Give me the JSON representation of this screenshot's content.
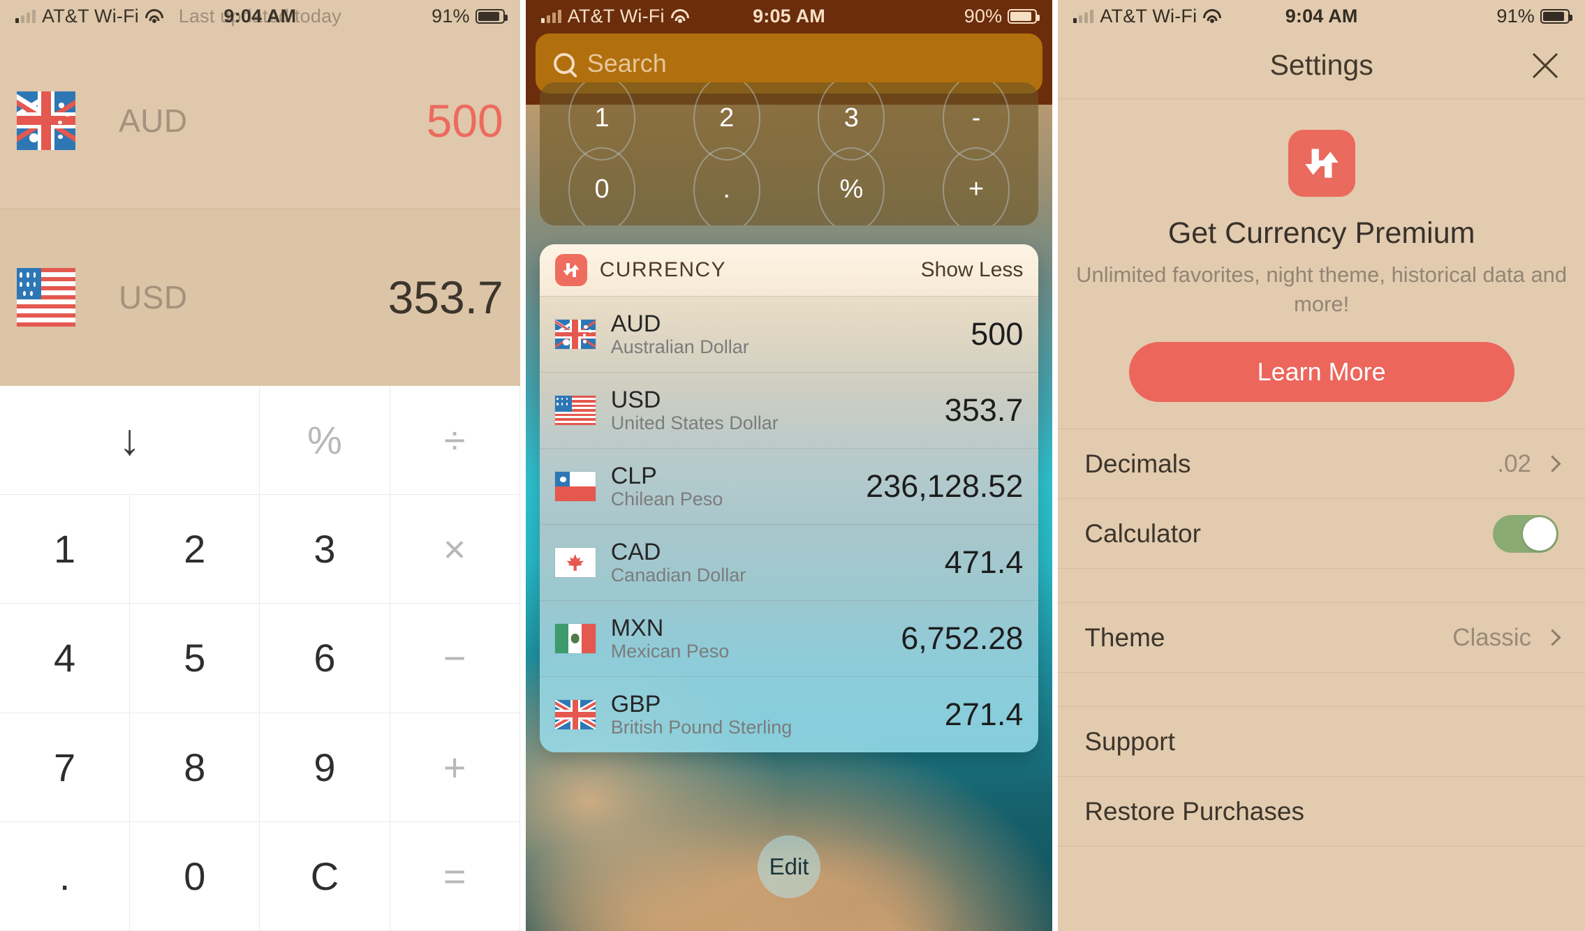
{
  "colors": {
    "accent_red": "#ec665c",
    "panel1_bg": "#dfc8ab",
    "panel3_bg": "#e2cbaf",
    "search_bar_bg": "#b1700d",
    "status_bar_dark": "#6b2d0c",
    "toggle_on_green": "#8aab73",
    "keypad_bg": "#ffffff"
  },
  "panel1": {
    "status": {
      "carrier": "AT&T Wi-Fi",
      "wifi_icon": "wifi-icon",
      "signal_icon": "signal-bars-icon",
      "time": "9:04 AM",
      "last_updated": "Last updated today",
      "battery_percent": "91%",
      "battery_icon": "battery-icon"
    },
    "converter": {
      "rows": [
        {
          "flag": "flag-au",
          "code": "AUD",
          "value": "500",
          "active": true
        },
        {
          "flag": "flag-us",
          "code": "USD",
          "value": "353.7",
          "active": false
        }
      ]
    },
    "keypad": [
      {
        "label": "↓",
        "name": "down-arrow-key",
        "type": "arrow",
        "wide": true
      },
      {
        "label": "%",
        "name": "percent-key",
        "type": "op"
      },
      {
        "label": "÷",
        "name": "divide-key",
        "type": "op"
      },
      {
        "label": "1",
        "name": "key-1",
        "type": "num"
      },
      {
        "label": "2",
        "name": "key-2",
        "type": "num"
      },
      {
        "label": "3",
        "name": "key-3",
        "type": "num"
      },
      {
        "label": "×",
        "name": "multiply-key",
        "type": "op"
      },
      {
        "label": "4",
        "name": "key-4",
        "type": "num"
      },
      {
        "label": "5",
        "name": "key-5",
        "type": "num"
      },
      {
        "label": "6",
        "name": "key-6",
        "type": "num"
      },
      {
        "label": "−",
        "name": "minus-key",
        "type": "op"
      },
      {
        "label": "7",
        "name": "key-7",
        "type": "num"
      },
      {
        "label": "8",
        "name": "key-8",
        "type": "num"
      },
      {
        "label": "9",
        "name": "key-9",
        "type": "num"
      },
      {
        "label": "+",
        "name": "plus-key",
        "type": "op"
      },
      {
        "label": ".",
        "name": "decimal-key",
        "type": "num"
      },
      {
        "label": "0",
        "name": "key-0",
        "type": "num"
      },
      {
        "label": "C",
        "name": "clear-key",
        "type": "num"
      },
      {
        "label": "=",
        "name": "equals-key",
        "type": "op"
      }
    ]
  },
  "panel2": {
    "status": {
      "carrier": "AT&T Wi-Fi",
      "time": "9:05 AM",
      "battery_percent": "90%"
    },
    "search": {
      "placeholder": "Search",
      "icon": "search-icon"
    },
    "calculator_widget": {
      "keys": [
        "1",
        "2",
        "3",
        "-",
        "0",
        ".",
        "%",
        "+"
      ]
    },
    "currency_widget": {
      "app_icon": "currency-exchange-icon",
      "title": "CURRENCY",
      "show_less": "Show Less",
      "rows": [
        {
          "flag": "flag-au",
          "code": "AUD",
          "name": "Australian Dollar",
          "value": "500"
        },
        {
          "flag": "flag-us",
          "code": "USD",
          "name": "United States Dollar",
          "value": "353.7"
        },
        {
          "flag": "flag-cl",
          "code": "CLP",
          "name": "Chilean Peso",
          "value": "236,128.52"
        },
        {
          "flag": "flag-ca",
          "code": "CAD",
          "name": "Canadian Dollar",
          "value": "471.4"
        },
        {
          "flag": "flag-mx",
          "code": "MXN",
          "name": "Mexican Peso",
          "value": "6,752.28"
        },
        {
          "flag": "flag-gb",
          "code": "GBP",
          "name": "British Pound Sterling",
          "value": "271.4"
        }
      ]
    },
    "edit_button": "Edit"
  },
  "panel3": {
    "status": {
      "carrier": "AT&T Wi-Fi",
      "time": "9:04 AM",
      "battery_percent": "91%"
    },
    "nav": {
      "title": "Settings",
      "close_icon": "close-icon"
    },
    "promo": {
      "icon": "currency-exchange-icon",
      "heading": "Get Currency Premium",
      "subtitle": "Unlimited favorites, night theme, historical data and more!",
      "cta": "Learn More"
    },
    "settings_group_1": [
      {
        "label": "Decimals",
        "value": ".02",
        "control": "chevron"
      },
      {
        "label": "Calculator",
        "value": "on",
        "control": "toggle"
      }
    ],
    "settings_group_2": [
      {
        "label": "Theme",
        "value": "Classic",
        "control": "chevron"
      }
    ],
    "settings_group_3": [
      {
        "label": "Support",
        "value": "",
        "control": "none"
      },
      {
        "label": "Restore Purchases",
        "value": "",
        "control": "none"
      }
    ]
  }
}
